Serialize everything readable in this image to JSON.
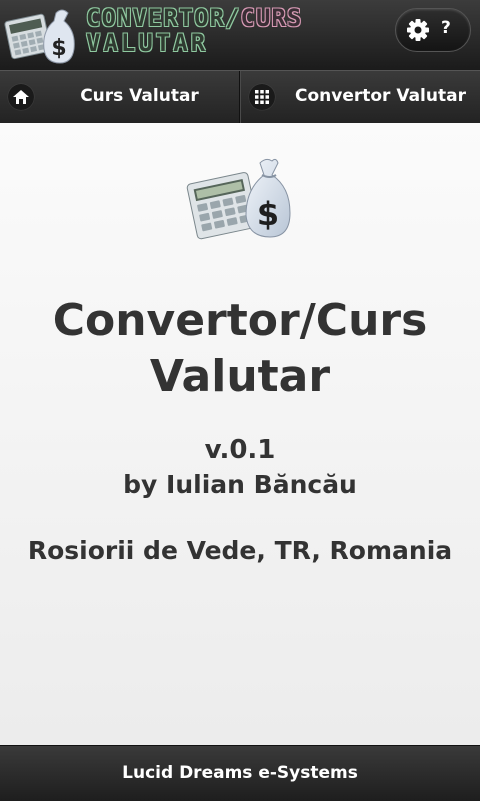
{
  "header": {
    "logo_line1_part1": "CONVERTOR/",
    "logo_line1_part2": "CURS",
    "logo_line2": "VALUTAR",
    "settings_icon": "gear-icon",
    "help_label": "?"
  },
  "nav": {
    "tabs": [
      {
        "label": "Curs Valutar",
        "icon": "home-icon"
      },
      {
        "label": "Convertor Valutar",
        "icon": "grid-icon"
      }
    ]
  },
  "main": {
    "app_icon": "calculator-money-bag-icon",
    "title_line1": "Convertor/Curs",
    "title_line2": "Valutar",
    "version": "v.0.1",
    "author": "by Iulian Băncău",
    "location": "Rosiorii de Vede, TR, Romania"
  },
  "footer": {
    "text": "Lucid Dreams e-Systems"
  },
  "colors": {
    "bar_dark": "#1b1b1b",
    "logo_green": "#8fc9a0",
    "logo_pink": "#d89ab5",
    "content_bg": "#f4f4f4",
    "text_dark": "#333333"
  }
}
